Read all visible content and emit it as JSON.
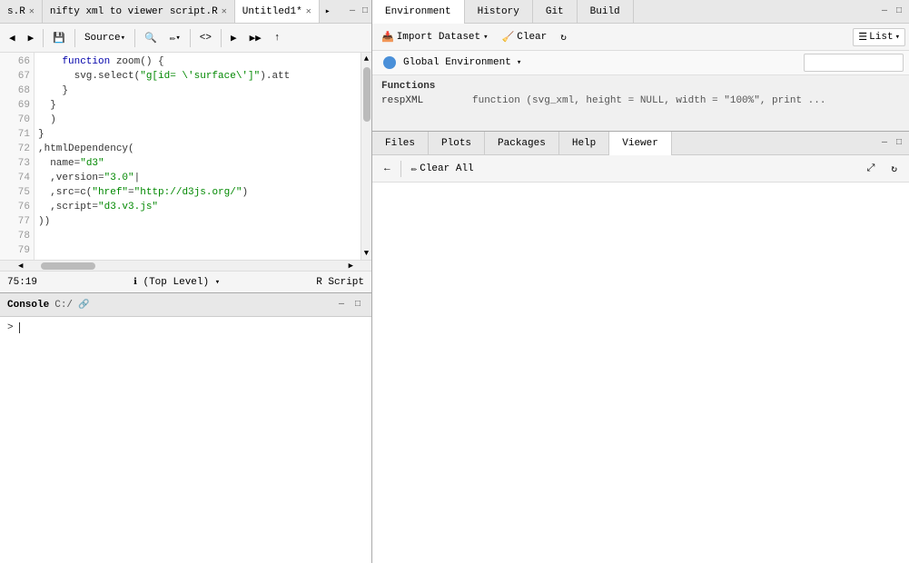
{
  "editor": {
    "tabs": [
      {
        "label": "s.R",
        "active": false,
        "closeable": true
      },
      {
        "label": "nifty xml to viewer script.R",
        "active": false,
        "closeable": true
      },
      {
        "label": "Untitled1*",
        "active": true,
        "closeable": true
      }
    ],
    "toolbar": {
      "save_label": "💾",
      "source_label": "Source",
      "search_label": "🔍",
      "wand_label": "✏",
      "code_label": "< >",
      "run_label": "▶",
      "run_all_label": "▶▶",
      "publish_label": "↑"
    },
    "lines": [
      {
        "num": "66",
        "code": "    function zoom() {"
      },
      {
        "num": "67",
        "code": "      svg.select(\"g[id= \\'surface\\']\").att"
      },
      {
        "num": "68",
        "code": "    }"
      },
      {
        "num": "69",
        "code": "  }"
      },
      {
        "num": "70",
        "code": "  )"
      },
      {
        "num": "71",
        "code": "}"
      },
      {
        "num": "72",
        "code": ""
      },
      {
        "num": "73",
        "code": ",htmlDependency("
      },
      {
        "num": "74",
        "code": "  name=\"d3\""
      },
      {
        "num": "75",
        "code": "  ,version=\"3.0\""
      },
      {
        "num": "76",
        "code": "  ,src=c(\"href\"=\"http://d3js.org/\")"
      },
      {
        "num": "77",
        "code": "  ,script=\"d3.v3.js\""
      },
      {
        "num": "78",
        "code": ""
      },
      {
        "num": "79",
        "code": "))"
      }
    ],
    "footer": {
      "position": "75:19",
      "scope": "(Top Level)",
      "type": "R Script"
    }
  },
  "console": {
    "title": "Console",
    "path": "C:/",
    "prompt": ">"
  },
  "environment": {
    "tabs": [
      {
        "label": "Environment",
        "active": true
      },
      {
        "label": "History",
        "active": false
      },
      {
        "label": "Git",
        "active": false
      },
      {
        "label": "Build",
        "active": false
      }
    ],
    "toolbar": {
      "import_label": "Import Dataset",
      "clear_label": "Clear",
      "refresh_label": "↻",
      "list_label": "List"
    },
    "env_selector": "Global Environment",
    "sections": [
      {
        "title": "Functions",
        "rows": [
          {
            "name": "respXML",
            "value": "function (svg_xml, height = NULL, width = \"100%\", print ..."
          }
        ]
      }
    ]
  },
  "files_panel": {
    "tabs": [
      {
        "label": "Files",
        "active": false
      },
      {
        "label": "Plots",
        "active": false
      },
      {
        "label": "Packages",
        "active": false
      },
      {
        "label": "Help",
        "active": false
      },
      {
        "label": "Viewer",
        "active": true
      }
    ],
    "toolbar": {
      "back_label": "←",
      "clear_all_label": "Clear All",
      "forward_label": "→",
      "refresh_label": "↻"
    }
  }
}
